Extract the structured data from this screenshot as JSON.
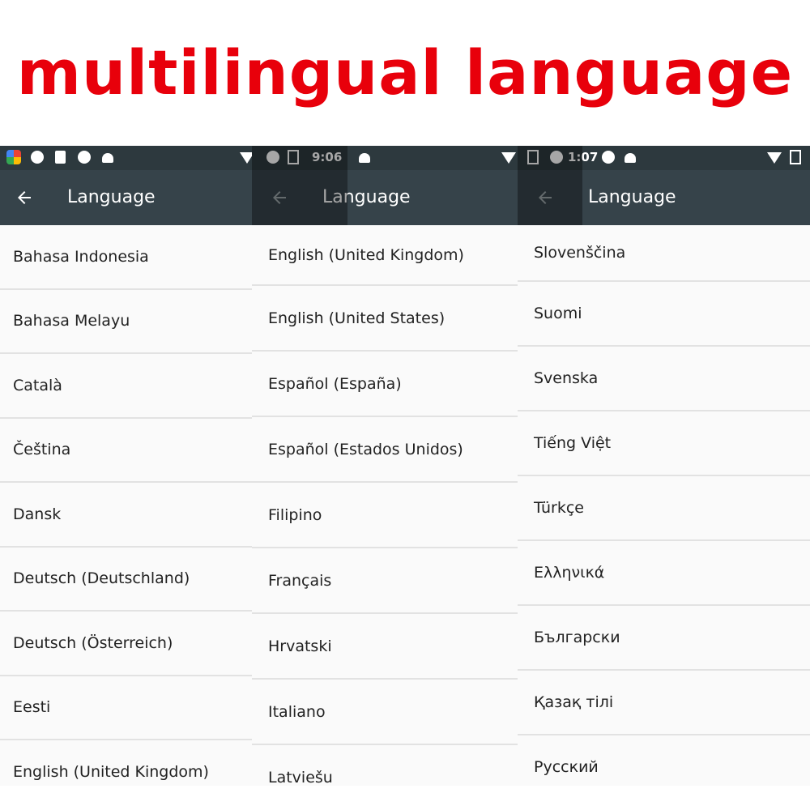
{
  "headline": "multilingual language",
  "colors": {
    "headline": "#e8000b",
    "statusbar": "#2d393e",
    "appbar": "#36434a",
    "list_bg": "#fafafa"
  },
  "panels": [
    {
      "title": "Language",
      "status_time": "",
      "items": [
        "Bahasa Indonesia",
        "Bahasa Melayu",
        "Català",
        "Čeština",
        "Dansk",
        "Deutsch (Deutschland)",
        "Deutsch (Österreich)",
        "Eesti",
        "English (United Kingdom)"
      ]
    },
    {
      "title": "Language",
      "status_time": "9:06",
      "items": [
        "English (United Kingdom)",
        "English (United States)",
        "Español (España)",
        "Español (Estados Unidos)",
        "Filipino",
        "Français",
        "Hrvatski",
        "Italiano",
        "Latviešu"
      ]
    },
    {
      "title": "Language",
      "status_time": "1:07",
      "items": [
        "Slovenščina",
        "Suomi",
        "Svenska",
        "Tiếng Việt",
        "Türkçe",
        "Ελληνικά",
        "Български",
        "Қазақ тілі",
        "Русский"
      ]
    }
  ],
  "icons": [
    "back-arrow-icon",
    "photos-icon",
    "sd-card-icon",
    "fire-icon",
    "android-icon",
    "wifi-icon",
    "battery-icon",
    "notification-icon"
  ]
}
